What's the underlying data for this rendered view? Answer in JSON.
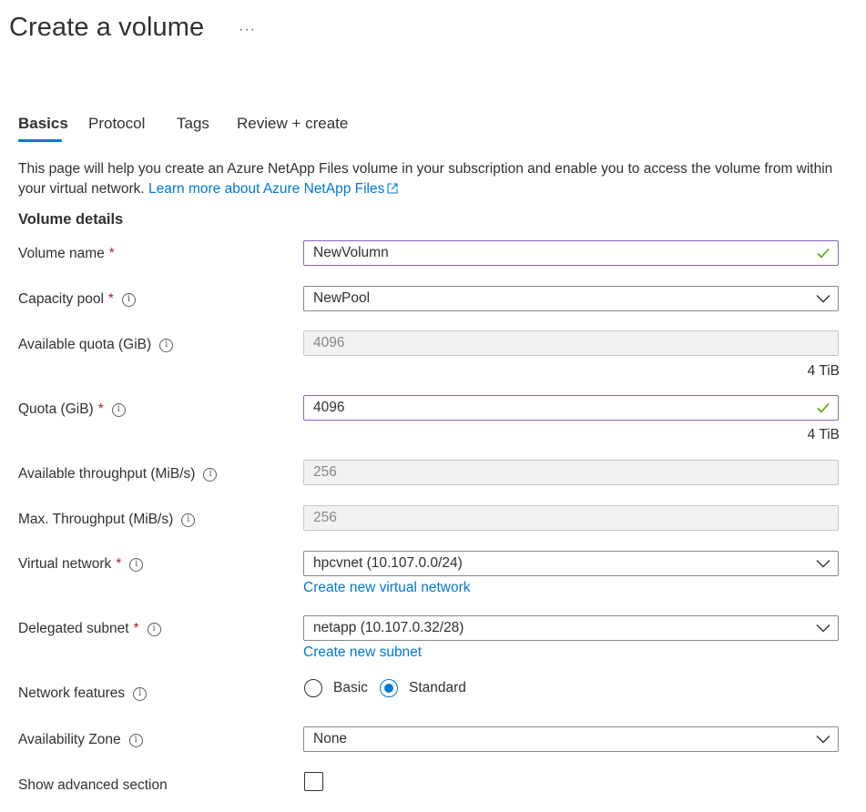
{
  "page": {
    "title": "Create a volume",
    "more_actions": "···"
  },
  "tabs": [
    {
      "label": "Basics",
      "active": true
    },
    {
      "label": "Protocol",
      "active": false
    },
    {
      "label": "Tags",
      "active": false
    },
    {
      "label": "Review + create",
      "active": false
    }
  ],
  "intro": {
    "text": "This page will help you create an Azure NetApp Files volume in your subscription and enable you to access the volume from within your virtual network.",
    "link": "Learn more about Azure NetApp Files"
  },
  "section_title": "Volume details",
  "fields": {
    "volume_name": {
      "label": "Volume name",
      "required": "*",
      "value": "NewVolumn"
    },
    "capacity_pool": {
      "label": "Capacity pool",
      "required": "*",
      "value": "NewPool"
    },
    "available_quota": {
      "label": "Available quota (GiB)",
      "value": "4096",
      "hint": "4 TiB"
    },
    "quota": {
      "label": "Quota (GiB)",
      "required": "*",
      "value": "4096",
      "hint": "4 TiB"
    },
    "available_throughput": {
      "label": "Available throughput (MiB/s)",
      "value": "256"
    },
    "max_throughput": {
      "label": "Max. Throughput (MiB/s)",
      "value": "256"
    },
    "virtual_network": {
      "label": "Virtual network",
      "required": "*",
      "value": "hpcvnet (10.107.0.0/24)",
      "link": "Create new virtual network"
    },
    "delegated_subnet": {
      "label": "Delegated subnet",
      "required": "*",
      "value": "netapp (10.107.0.32/28)",
      "link": "Create new subnet"
    },
    "network_features": {
      "label": "Network features",
      "options": [
        "Basic",
        "Standard"
      ],
      "selected": "Standard"
    },
    "availability_zone": {
      "label": "Availability Zone",
      "value": "None"
    },
    "show_advanced": {
      "label": "Show advanced section",
      "checked": false
    }
  },
  "colors": {
    "accent": "#0078d4",
    "valid_check": "#57a300",
    "valid_border": "#8764b8",
    "required": "#a4262c"
  },
  "icons": {
    "info": "i",
    "check": "check-icon",
    "chevron": "chevron-down-icon",
    "external": "external-link-icon"
  }
}
